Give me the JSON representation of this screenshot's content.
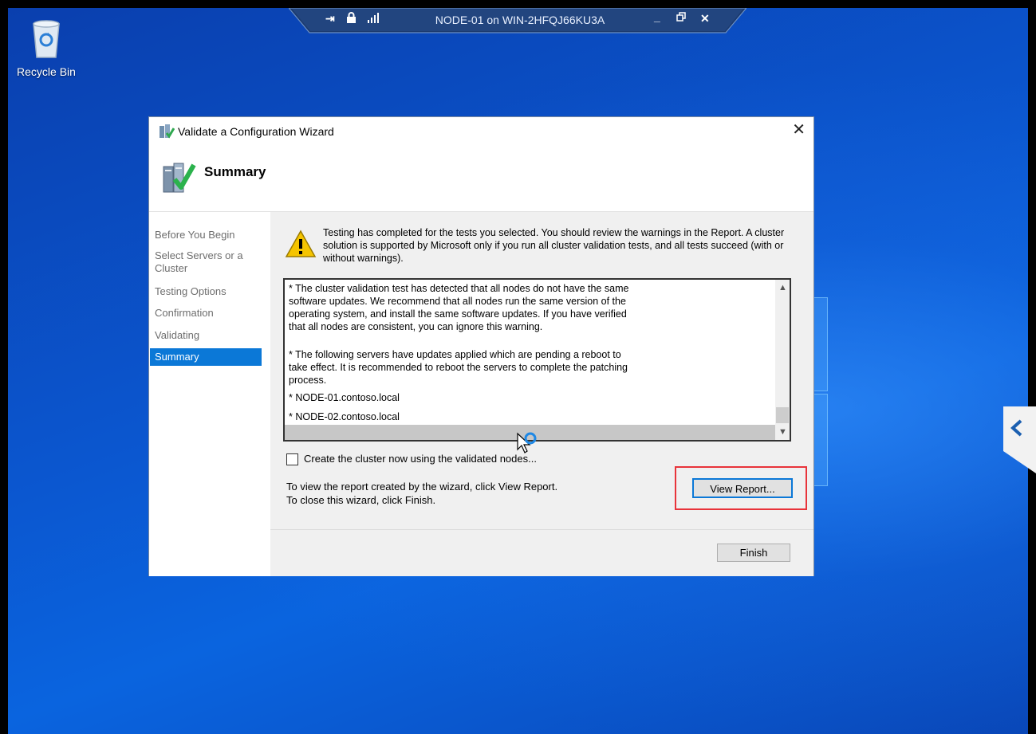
{
  "rdp_bar": {
    "title": "NODE-01 on WIN-2HFQJ66KU3A",
    "icons": [
      "pin-icon",
      "lock-icon",
      "signal-icon"
    ],
    "controls": [
      "minimize-icon",
      "restore-icon",
      "close-icon"
    ]
  },
  "desktop": {
    "recycle_bin_label": "Recycle Bin"
  },
  "dialog": {
    "title": "Validate a Configuration Wizard",
    "header": "Summary",
    "close_glyph": "✕",
    "nav": [
      "Before You Begin",
      "Select Servers or a Cluster",
      "Testing Options",
      "Confirmation",
      "Validating",
      "Summary"
    ],
    "selected_nav": "Summary",
    "intro": "Testing has completed for the tests you selected. You should review the warnings in the Report.  A cluster solution is supported by Microsoft only if you run all cluster validation tests, and all tests succeed (with or without warnings).",
    "messages": {
      "m1": "* The cluster validation test has detected that all nodes do not have the same software updates. We recommend that all nodes run the same version of the operating system, and install the same software updates. If you have verified that all nodes are consistent, you can ignore this warning.",
      "m2": "* The following servers have updates applied which are pending a reboot to take effect. It is recommended to reboot the servers to complete the patching process.",
      "m3": "* NODE-01.contoso.local",
      "m4": "* NODE-02.contoso.local"
    },
    "checkbox_label": "Create the cluster now using the validated nodes...",
    "checkbox_checked": false,
    "info_line1": "To view the report created by the wizard, click View Report.",
    "info_line2": "To close this wizard, click Finish.",
    "view_report_button": "View Report...",
    "finish_button": "Finish"
  },
  "colors": {
    "accent": "#0b78d7",
    "highlight": "#e8333a"
  }
}
